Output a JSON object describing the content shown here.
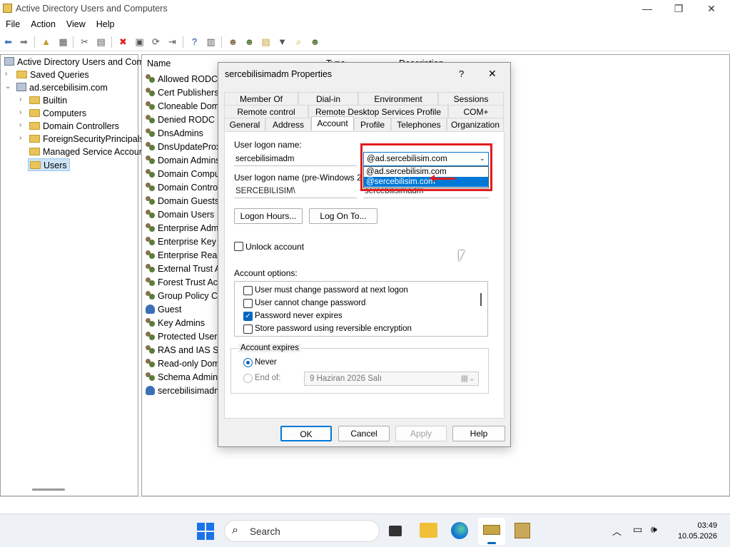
{
  "window": {
    "title": "Active Directory Users and Computers"
  },
  "menu": [
    "File",
    "Action",
    "View",
    "Help"
  ],
  "tree": {
    "root": "Active Directory Users and Com",
    "saved_queries": "Saved Queries",
    "domain": "ad.sercebilisim.com",
    "children": [
      "Builtin",
      "Computers",
      "Domain Controllers",
      "ForeignSecurityPrincipals",
      "Managed Service Accour",
      "Users"
    ]
  },
  "list": {
    "headers": [
      "Name",
      "Type",
      "Description"
    ],
    "rows": [
      "Allowed RODC P",
      "Cert Publishers",
      "Cloneable Doma",
      "Denied RODC Pa",
      "DnsAdmins",
      "DnsUpdateProxy",
      "Domain Admins",
      "Domain Compu",
      "Domain Control",
      "Domain Guests",
      "Domain Users",
      "Enterprise Admi",
      "Enterprise Key A",
      "Enterprise Read-",
      "External Trust Ac",
      "Forest Trust Acc",
      "Group Policy Cre",
      "Guest",
      "Key Admins",
      "Protected Users",
      "RAS and IAS Ser",
      "Read-only Doma",
      "Schema Admins",
      "sercebilisimadm"
    ]
  },
  "dialog": {
    "title": "sercebilisimadm Properties",
    "help": "?",
    "close": "✕",
    "tabs_row1": [
      "Member Of",
      "Dial-in",
      "Environment",
      "Sessions"
    ],
    "tabs_row2": [
      "Remote control",
      "Remote Desktop Services Profile",
      "COM+"
    ],
    "tabs_row3": [
      "General",
      "Address",
      "Account",
      "Profile",
      "Telephones",
      "Organization"
    ],
    "logon_label": "User logon name:",
    "logon_value": "sercebilisimadm",
    "upn_selected": "@ad.sercebilisim.com",
    "upn_options": [
      "@ad.sercebilisim.com",
      "@sercebilisim.com"
    ],
    "prewin_label": "User logon name (pre-Windows 2000):",
    "prewin_domain": "SERCEBILISIM\\",
    "prewin_user": "sercebilisimadm",
    "logon_hours": "Logon Hours...",
    "logon_to": "Log On To...",
    "unlock": "Unlock account",
    "options_label": "Account options:",
    "options": [
      {
        "label": "User must change password at next logon",
        "checked": false
      },
      {
        "label": "User cannot change password",
        "checked": false
      },
      {
        "label": "Password never expires",
        "checked": true
      },
      {
        "label": "Store password using reversible encryption",
        "checked": false
      }
    ],
    "expires_label": "Account expires",
    "never": "Never",
    "end_of": "End of:",
    "end_date": "9 Haziran 2026     Salı",
    "ok": "OK",
    "cancel": "Cancel",
    "apply": "Apply",
    "helpbtn": "Help"
  },
  "taskbar": {
    "search": "Search",
    "time": "03:49",
    "date": "10.05.2026"
  },
  "colors": {
    "accent": "#0078d7",
    "highlight": "#e21c1c"
  }
}
